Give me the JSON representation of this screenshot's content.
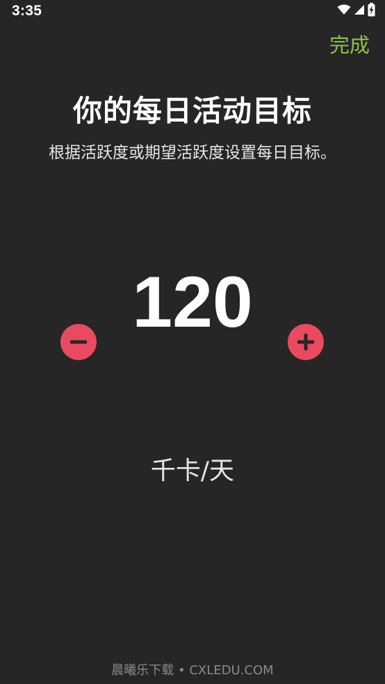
{
  "status_bar": {
    "time": "3:35",
    "icons": [
      "wifi-icon",
      "cellular-signal-icon",
      "battery-charging-icon"
    ]
  },
  "header": {
    "done_label": "完成"
  },
  "main": {
    "title": "你的每日活动目标",
    "subtitle": "根据活跃度或期望活跃度设置每日目标。",
    "goal_value": "120",
    "unit": "千卡/天"
  },
  "stepper": {
    "decrease_icon": "minus-icon",
    "increase_icon": "plus-icon"
  },
  "footer": {
    "watermark": "晨曦乐下载 • CXLEDU.COM"
  },
  "colors": {
    "background": "#262626",
    "accent_done": "#8bc34a",
    "button_red": "#ea4a5f",
    "text_primary": "#ffffff"
  }
}
